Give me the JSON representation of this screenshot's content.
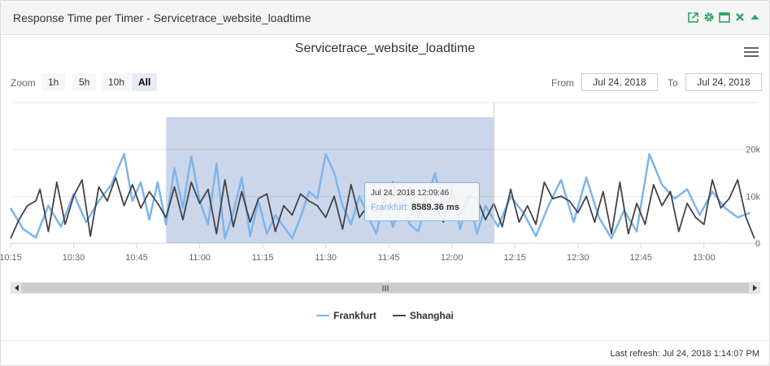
{
  "panel": {
    "title": "Response Time per Timer - Servicetrace_website_loadtime",
    "tool_icons": [
      "external-link-icon",
      "gear-icon",
      "maximize-icon",
      "close-icon",
      "collapse-icon"
    ],
    "accent_color": "#2aa65d"
  },
  "controls": {
    "zoom_label": "Zoom",
    "zoom_buttons": [
      "1h",
      "5h",
      "10h",
      "All"
    ],
    "active_zoom": "All",
    "from_label": "From",
    "from_value": "Jul 24, 2018",
    "to_label": "To",
    "to_value": "Jul 24, 2018"
  },
  "tooltip": {
    "date": "Jul 24, 2018 12:09:46",
    "series": "Frankfurt:",
    "value": "8589.36 ms"
  },
  "footer": {
    "last_refresh": "Last refresh: Jul 24, 2018 1:14:07 PM"
  },
  "chart_data": {
    "type": "line",
    "title": "Servicetrace_website_loadtime",
    "x_tick_labels": [
      "10:15",
      "10:30",
      "10:45",
      "11:00",
      "11:15",
      "11:30",
      "11:45",
      "12:00",
      "12:15",
      "12:30",
      "12:45",
      "13:00"
    ],
    "x_tick_minutes": [
      615,
      630,
      645,
      660,
      675,
      690,
      705,
      720,
      735,
      750,
      765,
      780
    ],
    "y_tick_labels": [
      "0",
      "10k",
      "20k"
    ],
    "y_tick_values": [
      0,
      10000,
      20000
    ],
    "ylim": [
      0,
      30000
    ],
    "xlim_minutes": [
      615,
      793
    ],
    "grid": true,
    "legend": "bottom-center",
    "selection_minutes": [
      652,
      730
    ],
    "series": [
      {
        "name": "Frankfurt",
        "color": "#7cb5ec",
        "x": [
          615,
          618,
          621,
          624,
          627,
          630,
          633,
          636,
          639,
          642,
          644,
          646,
          648,
          650,
          652,
          654,
          656,
          658,
          660,
          662,
          664,
          666,
          668,
          670,
          672,
          674,
          676,
          678,
          680,
          682,
          684,
          686,
          688,
          690,
          692,
          694,
          696,
          698,
          700,
          702,
          704,
          706,
          708,
          710,
          712,
          714,
          716,
          718,
          720,
          722,
          724,
          726,
          728,
          731,
          734,
          737,
          740,
          743,
          746,
          749,
          752,
          755,
          758,
          761,
          764,
          767,
          770,
          773,
          776,
          779,
          782,
          785,
          788,
          791
        ],
        "y": [
          7500,
          3000,
          1200,
          8000,
          3500,
          10500,
          4500,
          9000,
          12500,
          19000,
          9000,
          13000,
          5000,
          13000,
          4000,
          16000,
          7500,
          18500,
          9000,
          4000,
          17000,
          1000,
          6500,
          14000,
          1500,
          9000,
          2000,
          6000,
          3500,
          1000,
          5500,
          11000,
          9500,
          19000,
          15000,
          8000,
          4000,
          10000,
          6000,
          2000,
          9500,
          3500,
          8589,
          4000,
          2500,
          9000,
          15000,
          6000,
          11500,
          3000,
          9500,
          2000,
          8000,
          3500,
          10000,
          6500,
          1500,
          8000,
          13500,
          4500,
          14000,
          5500,
          1000,
          7000,
          2500,
          19000,
          12500,
          9500,
          11500,
          6000,
          11000,
          7500,
          5500,
          6500
        ]
      },
      {
        "name": "Shanghai",
        "color": "#434348",
        "x": [
          615,
          617,
          619,
          621,
          622,
          624,
          626,
          628,
          630,
          632,
          634,
          636,
          638,
          640,
          642,
          644,
          646,
          648,
          650,
          652,
          654,
          656,
          658,
          660,
          662,
          664,
          666,
          668,
          670,
          672,
          674,
          676,
          678,
          680,
          682,
          684,
          686,
          688,
          690,
          692,
          694,
          696,
          698,
          700,
          702,
          704,
          706,
          708,
          710,
          712,
          714,
          716,
          718,
          720,
          722,
          724,
          726,
          728,
          730,
          732,
          734,
          736,
          738,
          740,
          742,
          744,
          746,
          748,
          750,
          752,
          754,
          756,
          758,
          760,
          762,
          764,
          766,
          768,
          770,
          772,
          774,
          776,
          778,
          780,
          782,
          784,
          786,
          788,
          790,
          792
        ],
        "y": [
          1000,
          5000,
          8000,
          9000,
          11500,
          2500,
          13000,
          4000,
          10000,
          13500,
          1500,
          12000,
          9000,
          14000,
          8000,
          12500,
          7500,
          11000,
          8500,
          5500,
          12000,
          5000,
          13000,
          8500,
          11500,
          2000,
          13500,
          3500,
          11000,
          4500,
          9500,
          10500,
          2500,
          8000,
          6000,
          10500,
          9000,
          8000,
          5500,
          10000,
          3000,
          12500,
          5500,
          8000,
          6500,
          9000,
          13000,
          7500,
          12000,
          5500,
          10500,
          8000,
          4500,
          11500,
          6000,
          10000,
          9500,
          5000,
          8500,
          3500,
          11500,
          4500,
          8000,
          4000,
          13000,
          9500,
          10000,
          9000,
          6500,
          10000,
          4500,
          11000,
          2000,
          13000,
          2000,
          8500,
          4000,
          12500,
          8000,
          11000,
          2500,
          8500,
          5500,
          4000,
          13500,
          7500,
          9500,
          13500,
          5500,
          1000
        ]
      }
    ]
  }
}
